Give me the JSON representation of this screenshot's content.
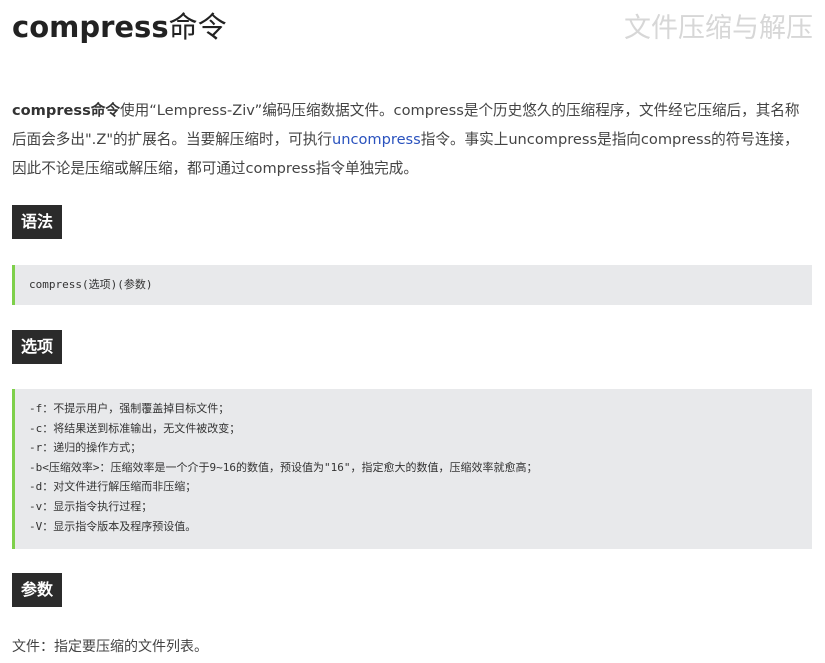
{
  "header": {
    "title_cmd": "compress",
    "title_suffix": "命令",
    "subtitle": "文件压缩与解压"
  },
  "intro": {
    "strong": "compress命令",
    "part1": "使用“Lempress-Ziv”编码压缩数据文件。compress是个历史悠久的压缩程序，文件经它压缩后，其名称后面会多出\".Z\"的扩展名。当要解压缩时，可执行",
    "link": "uncompress",
    "part2": "指令。事实上uncompress是指向compress的符号连接，因此不论是压缩或解压缩，都可通过compress指令单独完成。"
  },
  "sections": {
    "syntax": {
      "label": "语法",
      "code": "compress(选项)(参数)"
    },
    "options": {
      "label": "选项",
      "lines": [
        "-f：不提示用户，强制覆盖掉目标文件；",
        "-c：将结果送到标准输出，无文件被改变；",
        "-r：递归的操作方式；",
        "-b<压缩效率>：压缩效率是一个介于9~16的数值，预设值为\"16\"，指定愈大的数值，压缩效率就愈高；",
        "-d：对文件进行解压缩而非压缩；",
        "-v：显示指令执行过程；",
        "-V：显示指令版本及程序预设值。"
      ]
    },
    "params": {
      "label": "参数",
      "text": "文件：指定要压缩的文件列表。"
    }
  }
}
